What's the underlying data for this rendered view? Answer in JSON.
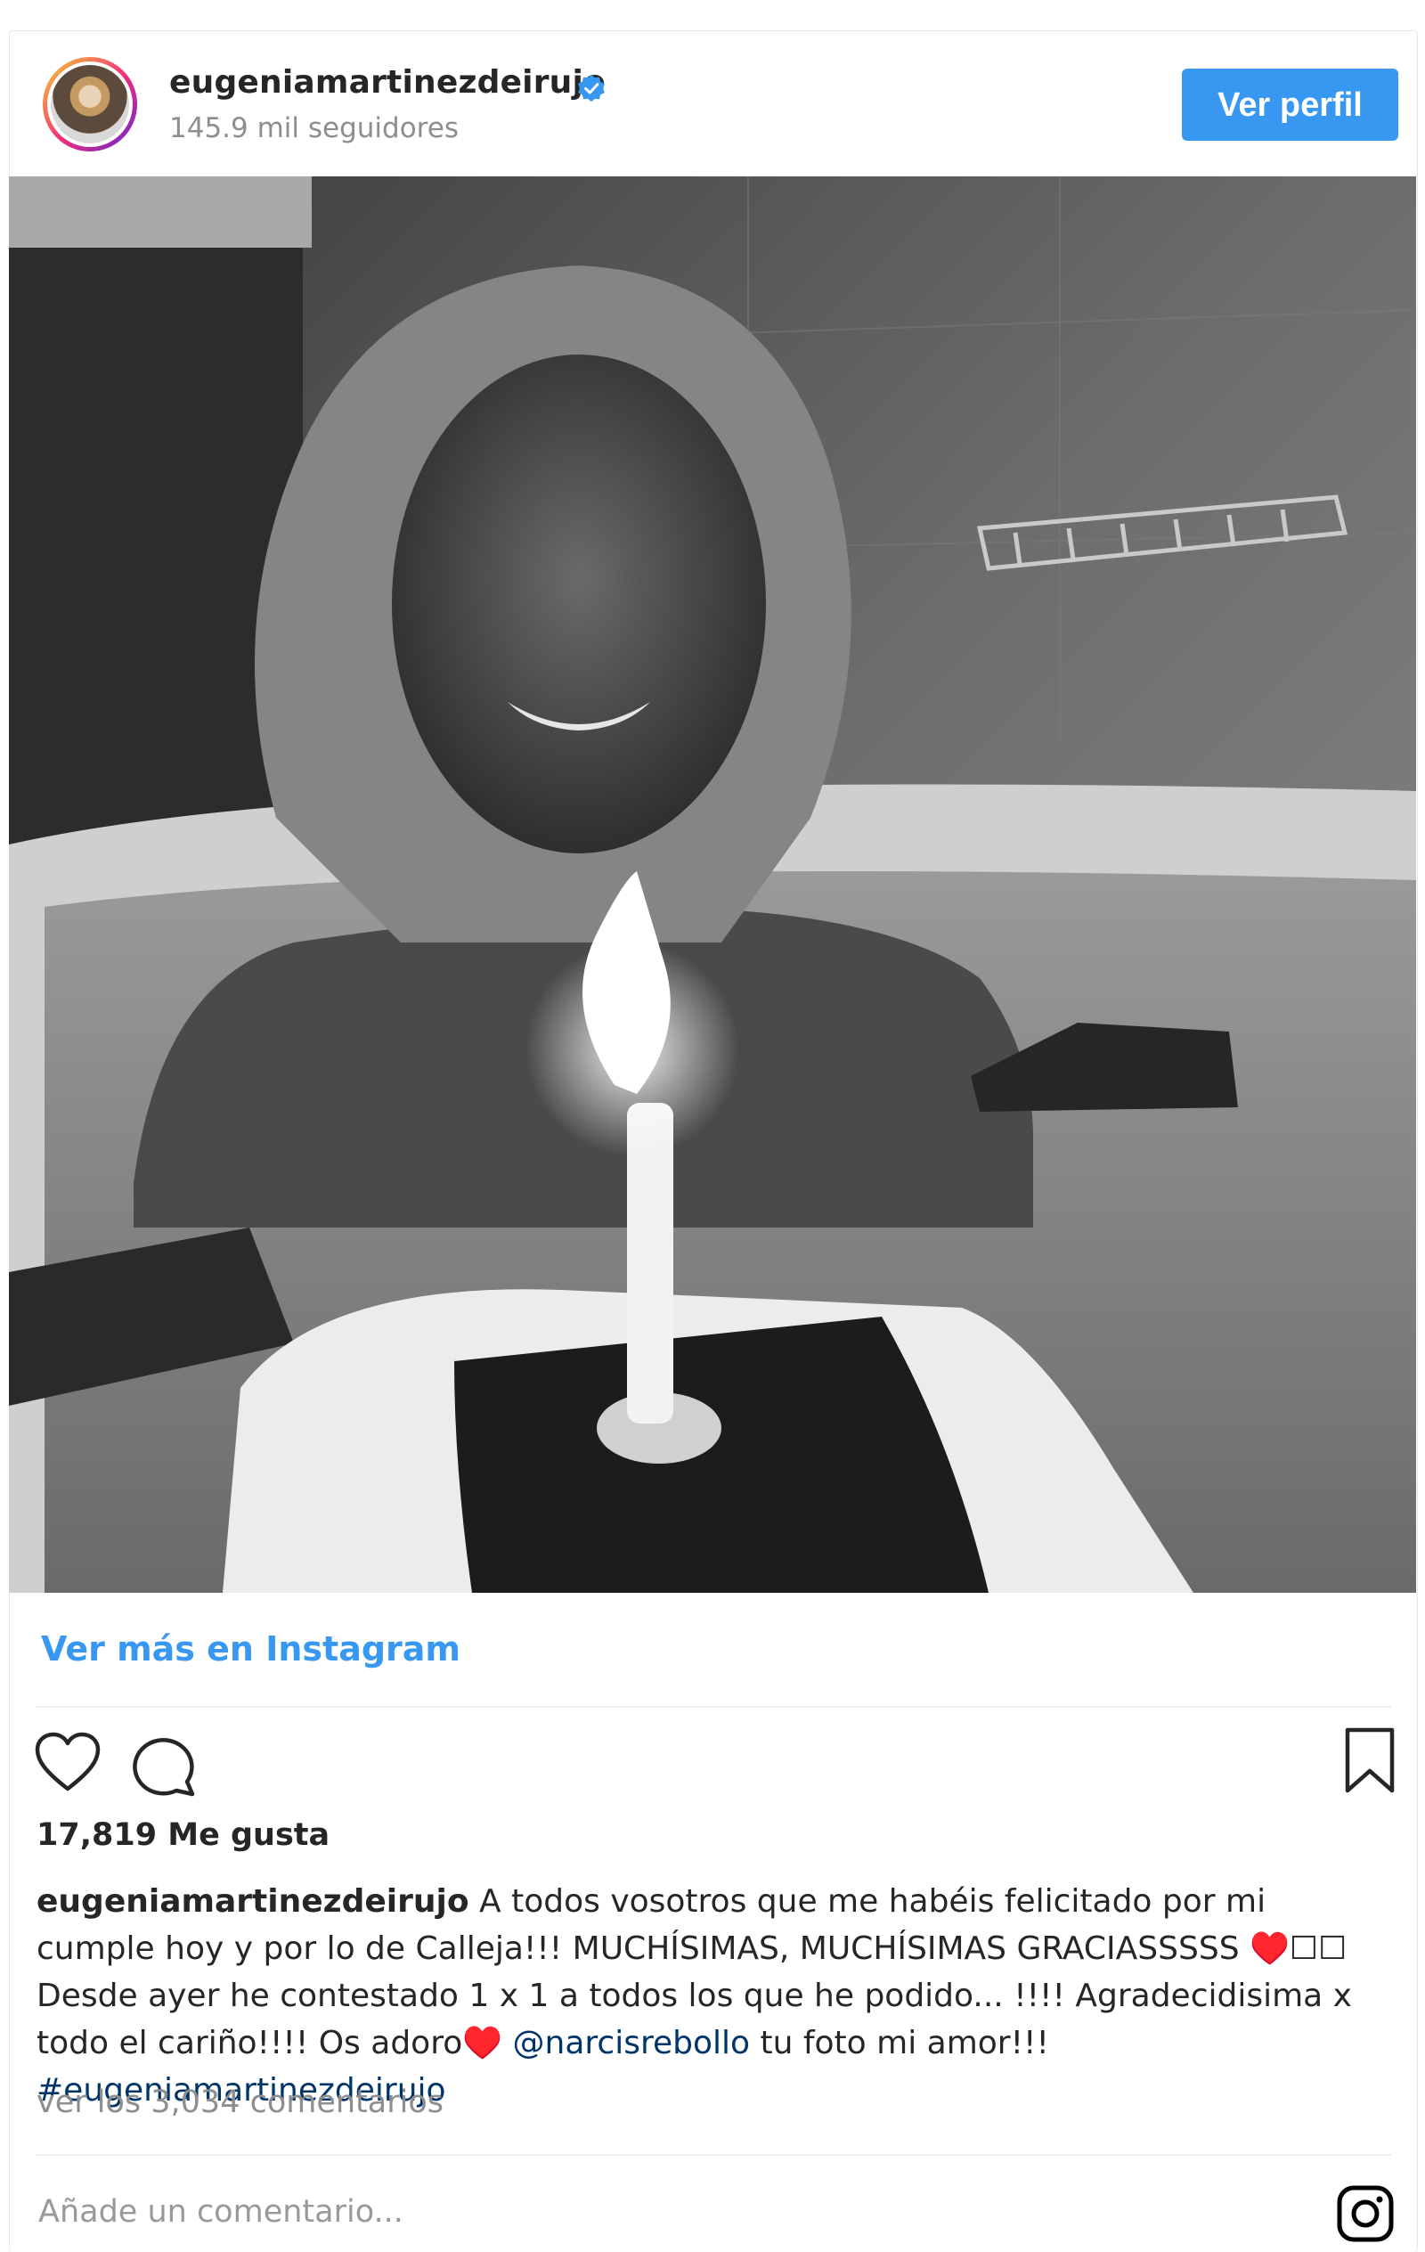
{
  "header": {
    "username": "eugeniamartinezdeirujo",
    "followers": "145.9 mil seguidores",
    "view_profile_label": "Ver perfil"
  },
  "post": {
    "view_more_label": "Ver más en Instagram",
    "likes": "17,819 Me gusta",
    "caption": {
      "user": "eugeniamartinezdeirujo",
      "text_1": "A todos vosotros que me habéis felicitado por mi cumple hoy y por lo de Calleja!!! MUCHÍSIMAS, MUCHÍSIMAS GRACIASSSSS ♥️☐☐ Desde ayer he contestado 1 x 1 a todos los que he podido... !!!! Agradecidisima x todo el cariño!!!! Os adoro♥️",
      "mention": "@narcisrebollo",
      "text_2": "tu foto mi amor!!!",
      "hashtag": "#eugeniamartinezdeirujo"
    },
    "comments_link": "ver los 3,034 comentarios",
    "comment_placeholder": "Añade un comentario..."
  },
  "colors": {
    "accent_blue": "#3897f0",
    "verified_blue": "#3897f0",
    "link_dark": "#003569"
  },
  "icons": [
    "verified-badge-icon",
    "heart-icon",
    "comment-icon",
    "bookmark-icon",
    "instagram-logo-icon"
  ]
}
